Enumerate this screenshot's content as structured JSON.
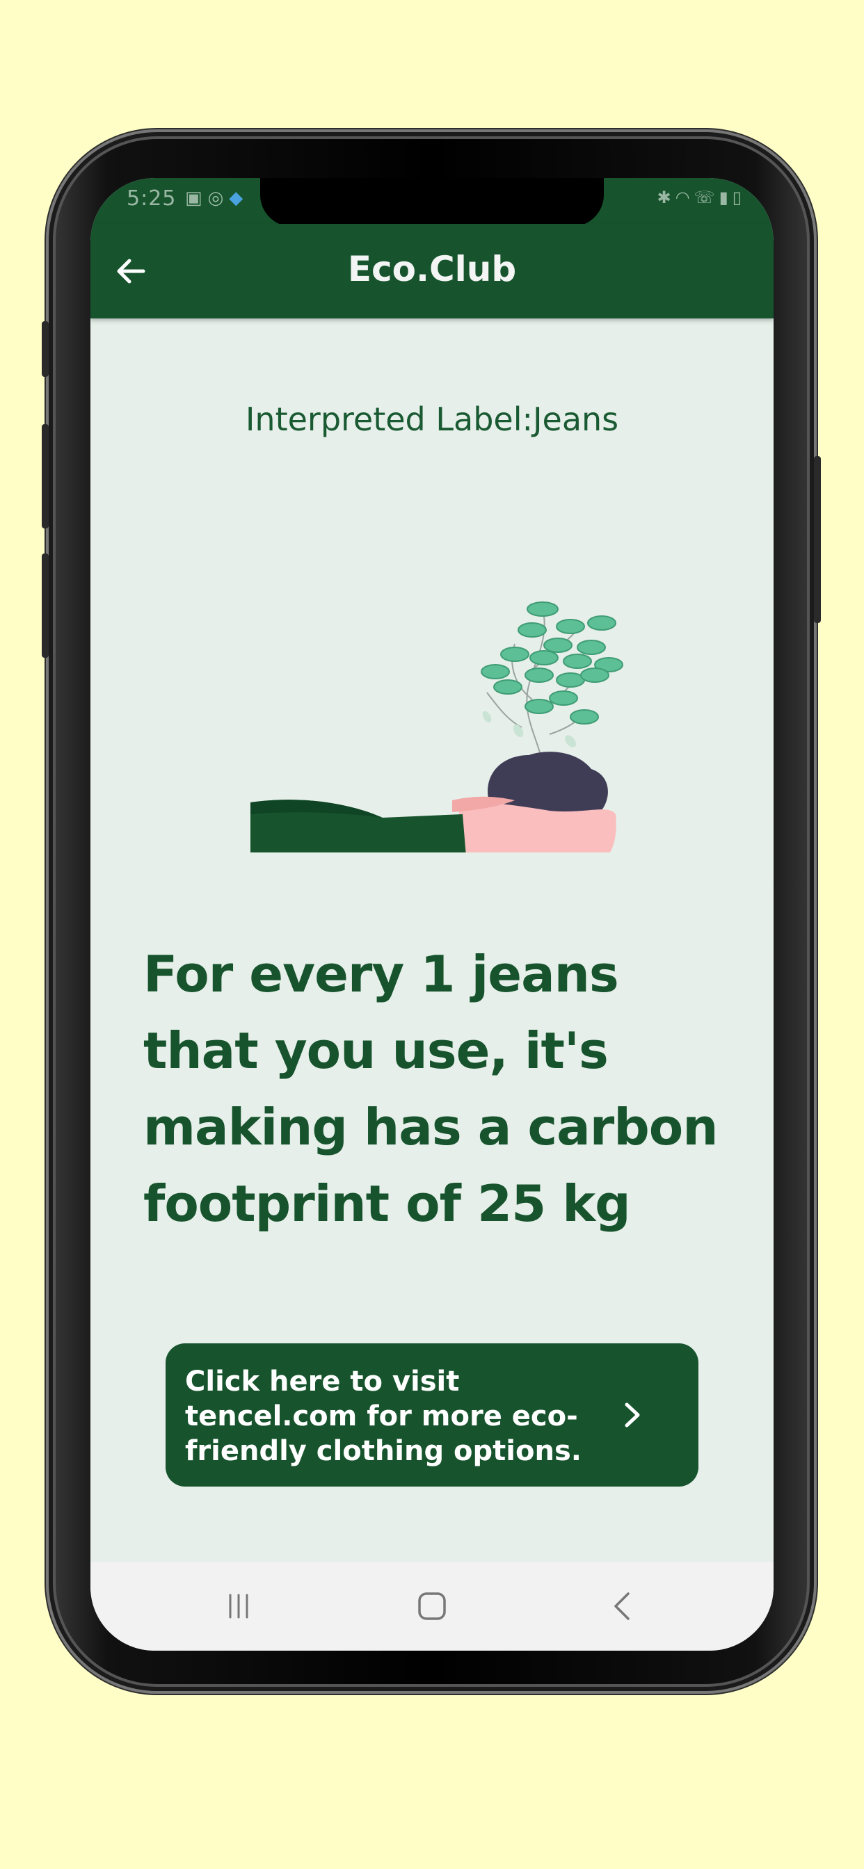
{
  "status_bar": {
    "time": "5:25",
    "left_icons": [
      "image-icon",
      "record-icon",
      "flutter-icon"
    ],
    "right_icons": [
      "bluetooth-icon",
      "wifi-icon",
      "call-icon",
      "signal-icon",
      "battery-icon"
    ]
  },
  "app_bar": {
    "title": "Eco.Club",
    "back_icon": "arrow-left-icon"
  },
  "main": {
    "interpreted_label": "Interpreted Label:Jeans",
    "headline": "For every 1 jeans that you use, it's making has a carbon footprint of 25 kg",
    "cta_text": "Click here to visit tencel.com for more eco-friendly clothing options.",
    "cta_icon": "chevron-right-icon"
  },
  "nav_bar": {
    "icons": [
      "recent-apps-icon",
      "home-icon",
      "back-icon"
    ]
  },
  "colors": {
    "background": "#fefec6",
    "primary": "#17542d",
    "screen_bg": "#e6efe9",
    "leaf": "#5cbf95",
    "soil": "#3f3d56",
    "hand": "#fbbebe"
  }
}
